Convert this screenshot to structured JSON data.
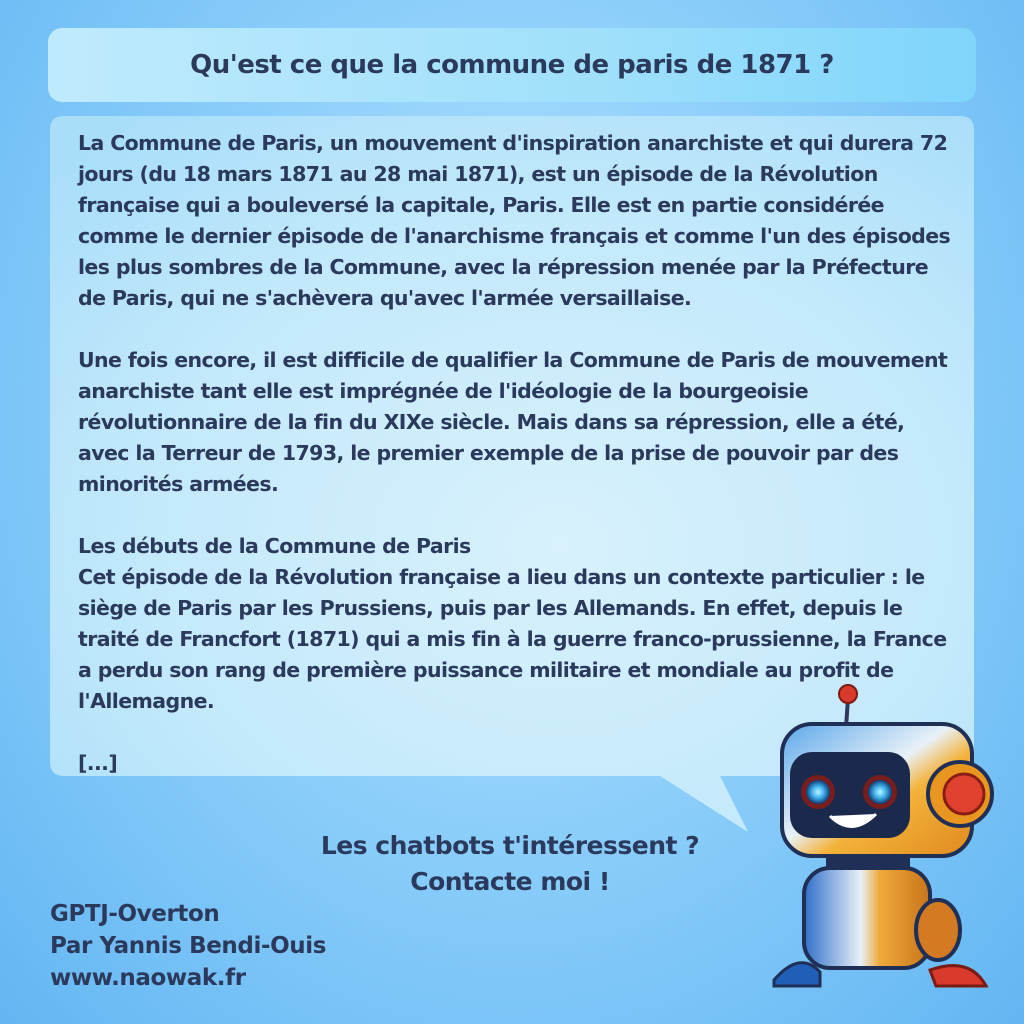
{
  "question": "Qu'est ce que la commune de paris de 1871 ?",
  "answer": {
    "paragraph1": "La Commune de Paris, un mouvement d'inspiration anarchiste et qui durera 72 jours (du 18 mars 1871 au 28 mai 1871), est un épisode de la Révolution française qui a bouleversé la capitale, Paris. Elle est en partie considérée comme le dernier épisode de l'anarchisme français et comme l'un des épisodes les plus sombres de la Commune, avec la répression menée par la Préfecture de Paris, qui ne s'achèvera qu'avec l'armée versaillaise.",
    "paragraph2": "Une fois encore, il est difficile de qualifier la Commune de Paris de mouvement anarchiste tant elle est imprégnée de l'idéologie de la bourgeoisie révolutionnaire de la fin du XIXe siècle. Mais dans sa répression, elle a été, avec la Terreur de 1793, le premier exemple de la prise de pouvoir par des minorités armées.",
    "section_heading": "Les débuts de la Commune de Paris",
    "paragraph3": "Cet épisode de la Révolution française a lieu dans un contexte particulier : le siège de Paris par les Prussiens, puis par les Allemands. En effet, depuis le traité de Francfort (1871) qui a mis fin à la guerre franco-prussienne, la France a perdu son rang de première puissance militaire et mondiale au profit de l'Allemagne.",
    "ellipsis": "[...]"
  },
  "cta": {
    "line1": "Les chatbots t'intéressent ?",
    "line2": "Contacte moi !"
  },
  "credits": {
    "name": "GPTJ-Overton",
    "author": "Par Yannis Bendi-Ouis",
    "website": "www.naowak.fr"
  },
  "colors": {
    "text": "#2b3a5c",
    "bubble": "#c6ecfc",
    "background": "#7cc3f5"
  },
  "icons": {
    "mascot": "robot-mascot-icon"
  }
}
